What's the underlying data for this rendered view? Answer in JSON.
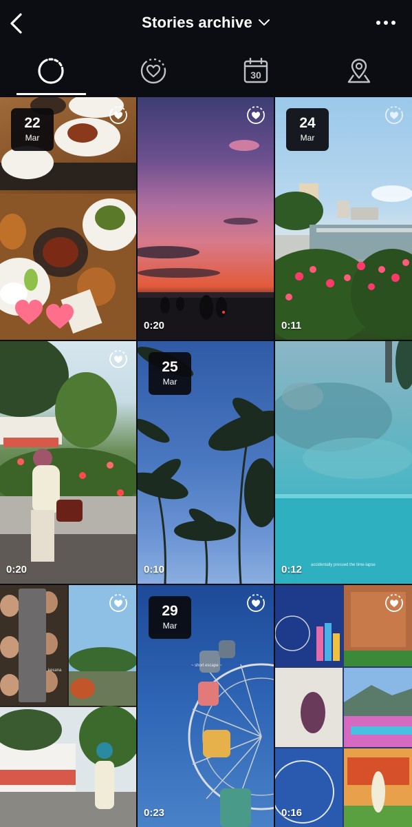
{
  "header": {
    "title": "Stories archive",
    "icons": [
      "back-arrow-icon",
      "chevron-down-icon",
      "more-options-icon"
    ]
  },
  "tabs": [
    {
      "name": "stories",
      "icon": "stories-ring-icon",
      "selected": true
    },
    {
      "name": "highlights",
      "icon": "heart-circle-icon",
      "selected": false
    },
    {
      "name": "calendar",
      "icon": "calendar-icon",
      "selected": false,
      "label": "30"
    },
    {
      "name": "map",
      "icon": "location-pin-icon",
      "selected": false
    }
  ],
  "stories": [
    {
      "day": "22",
      "month": "Mar",
      "duration": "",
      "subject": "food table with hearts"
    },
    {
      "day": "",
      "month": "",
      "duration": "0:20",
      "subject": "sunset sky with motorbikes"
    },
    {
      "day": "24",
      "month": "Mar",
      "duration": "0:11",
      "subject": "waterfront with flowers"
    },
    {
      "day": "",
      "month": "",
      "duration": "0:20",
      "subject": "woman sitting on wall with flowers"
    },
    {
      "day": "25",
      "month": "Mar",
      "duration": "0:10",
      "subject": "palm trees blue sky"
    },
    {
      "day": "",
      "month": "",
      "duration": "0:12",
      "subject": "underwater turquoise",
      "caption": "accidentally pressed the time-lapse"
    },
    {
      "day": "",
      "month": "",
      "duration": "",
      "subject": "collage of portraits and garden",
      "caption": "kesana"
    },
    {
      "day": "29",
      "month": "Mar",
      "duration": "0:23",
      "subject": "ferris wheel blue sky",
      "caption": "~ short escape ~"
    },
    {
      "day": "",
      "month": "",
      "duration": "0:16",
      "subject": "collage of colorful park"
    }
  ],
  "colors": {
    "background": "#0b0d13",
    "text": "#ffffff",
    "badge": "#0a0a0e"
  }
}
